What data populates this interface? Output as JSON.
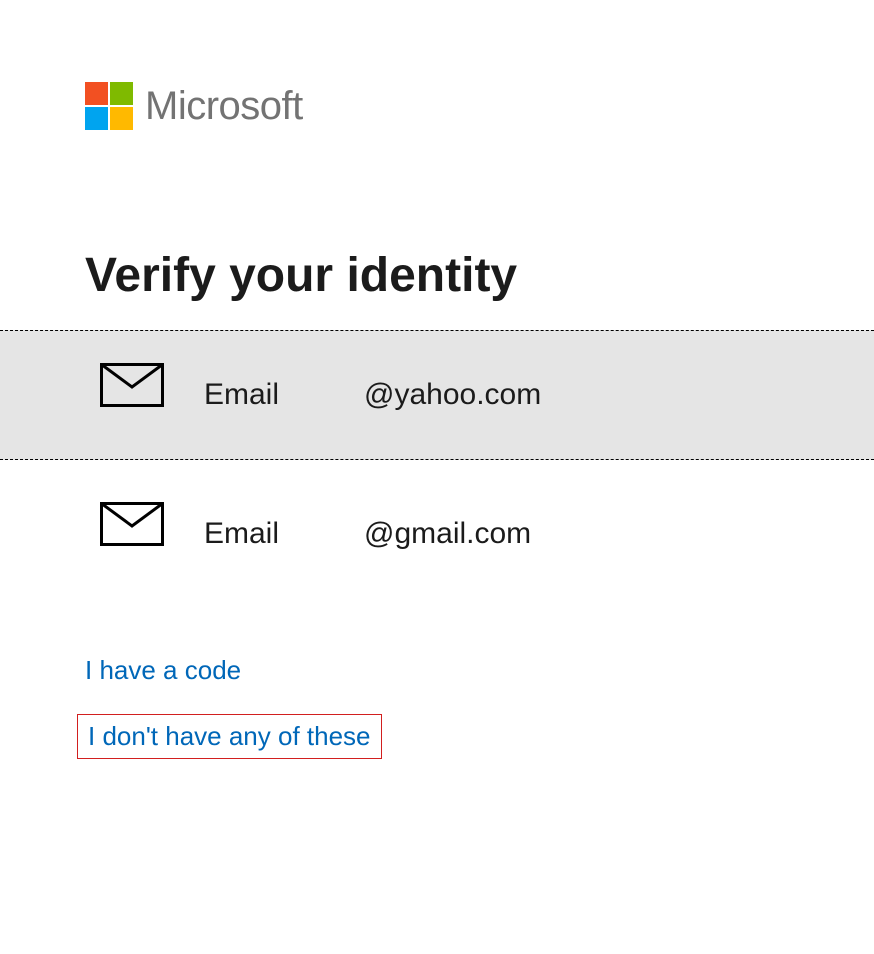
{
  "brand": {
    "name": "Microsoft"
  },
  "heading": "Verify your identity",
  "options": [
    {
      "label": "Email",
      "value": "@yahoo.com",
      "selected": true
    },
    {
      "label": "Email",
      "value": "@gmail.com",
      "selected": false
    }
  ],
  "links": {
    "have_code": "I have a code",
    "none": "I don't have any of these"
  }
}
